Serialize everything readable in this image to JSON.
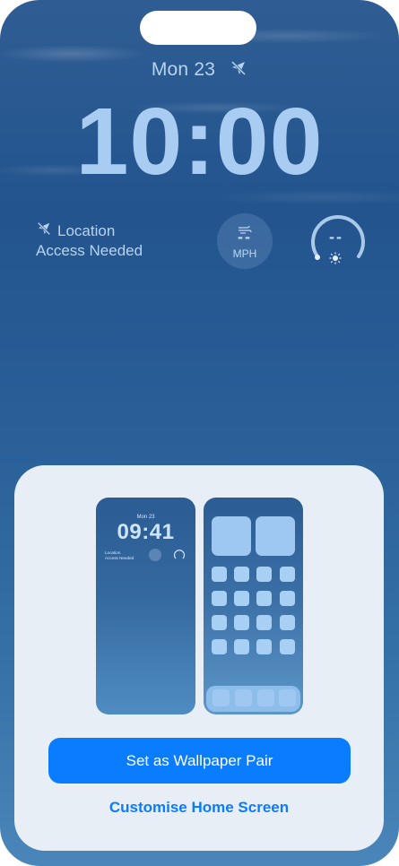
{
  "lock_screen": {
    "date": "Mon 23",
    "time": "10:00",
    "location_widget": {
      "line1": "Location",
      "line2": "Access Needed"
    },
    "wind_widget": {
      "value": "--",
      "unit": "MPH"
    },
    "gauge_widget": {
      "value": "--"
    }
  },
  "sheet": {
    "preview_lock": {
      "date": "Mon 23",
      "time": "09:41",
      "loc_line1": "Location",
      "loc_line2": "Access Needed"
    },
    "primary_button": "Set as Wallpaper Pair",
    "secondary_button": "Customise Home Screen"
  },
  "colors": {
    "accent": "#0a7cff",
    "sheet_bg": "#e8eef5",
    "wallpaper": "#2a5f98"
  },
  "icons": [
    "location-off-icon",
    "wind-icon",
    "sun-icon"
  ]
}
